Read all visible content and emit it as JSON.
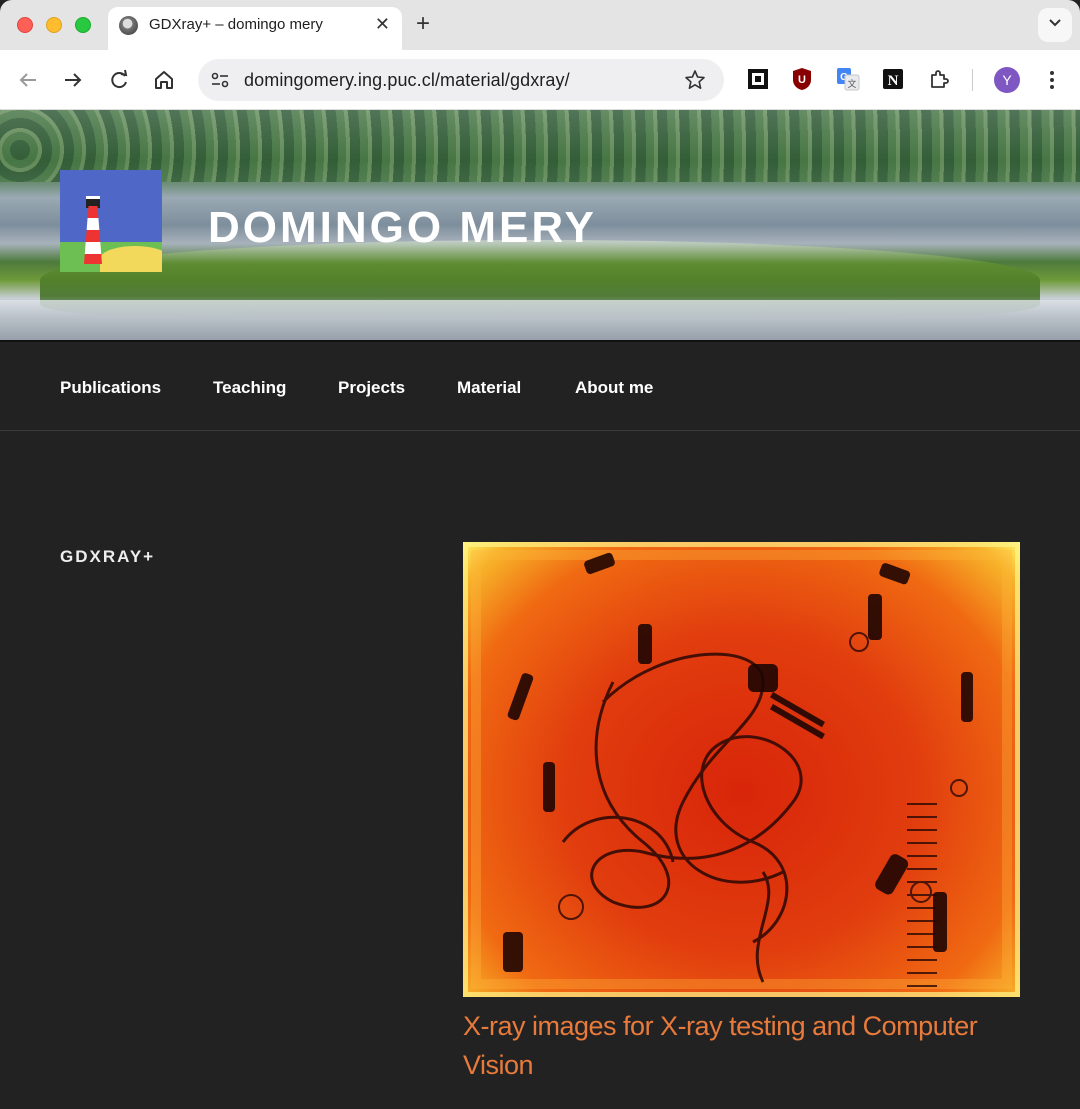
{
  "browser": {
    "tab_title": "GDXray+ – domingo mery",
    "url": "domingomery.ing.puc.cl/material/gdxray/",
    "avatar_letter": "Y",
    "extensions": [
      "qr-code-icon",
      "ublock-icon",
      "google-translate-icon",
      "notion-icon",
      "puzzle-extension-icon"
    ]
  },
  "site": {
    "title": "DOMINGO MERY",
    "nav": [
      "Publications",
      "Teaching",
      "Projects",
      "Material",
      "About me"
    ]
  },
  "entry": {
    "heading": "GDXRAY+",
    "image_caption": "X-ray images for X-ray testing and Computer Vision"
  },
  "colors": {
    "page_bg": "#222222",
    "caption": "#e87a3b",
    "avatar": "#7e57c2"
  }
}
